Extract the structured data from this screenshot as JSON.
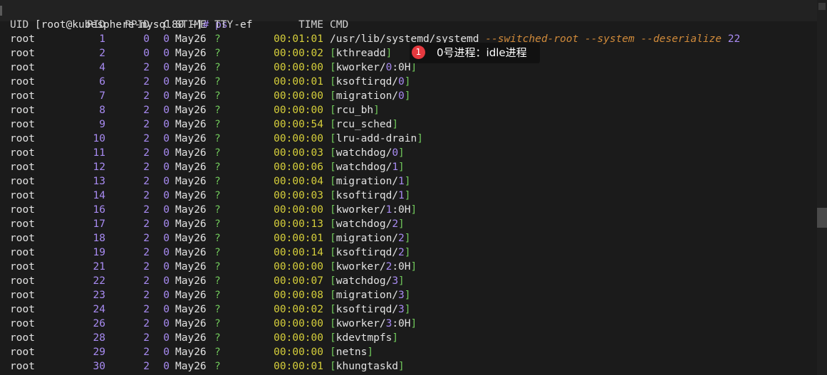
{
  "prompt": {
    "user_host": "[root@kubesphere-mysql80 ~]",
    "symbol": "#",
    "command": "ps",
    "args": "-ef"
  },
  "header": {
    "uid": "UID",
    "pid": "PID",
    "ppid": "PPID",
    "c": "C",
    "stime": "STIME",
    "tty": "TTY",
    "time": "TIME",
    "cmd": "CMD"
  },
  "rows": [
    {
      "uid": "root",
      "pid": "1",
      "ppid": "0",
      "c": "0",
      "stime": "May26",
      "tty": "?",
      "time": "00:01:01",
      "cmd_main": "/usr/lib/systemd/systemd",
      "cmd_opts": "--switched-root --system --deserialize",
      "cmd_num": "22"
    },
    {
      "uid": "root",
      "pid": "2",
      "ppid": "0",
      "c": "0",
      "stime": "May26",
      "tty": "?",
      "time": "00:00:02",
      "cmd_pre": "[",
      "cmd_name": "kthreadd",
      "cmd_suf": "]"
    },
    {
      "uid": "root",
      "pid": "4",
      "ppid": "2",
      "c": "0",
      "stime": "May26",
      "tty": "?",
      "time": "00:00:00",
      "cmd_pre": "[",
      "cmd_name": "kworker/",
      "cmd_n": "0",
      "cmd_tail": ":0H",
      "cmd_suf": "]"
    },
    {
      "uid": "root",
      "pid": "6",
      "ppid": "2",
      "c": "0",
      "stime": "May26",
      "tty": "?",
      "time": "00:00:01",
      "cmd_pre": "[",
      "cmd_name": "ksoftirqd/",
      "cmd_n": "0",
      "cmd_suf": "]"
    },
    {
      "uid": "root",
      "pid": "7",
      "ppid": "2",
      "c": "0",
      "stime": "May26",
      "tty": "?",
      "time": "00:00:00",
      "cmd_pre": "[",
      "cmd_name": "migration/",
      "cmd_n": "0",
      "cmd_suf": "]"
    },
    {
      "uid": "root",
      "pid": "8",
      "ppid": "2",
      "c": "0",
      "stime": "May26",
      "tty": "?",
      "time": "00:00:00",
      "cmd_pre": "[",
      "cmd_name": "rcu_bh",
      "cmd_suf": "]"
    },
    {
      "uid": "root",
      "pid": "9",
      "ppid": "2",
      "c": "0",
      "stime": "May26",
      "tty": "?",
      "time": "00:00:54",
      "cmd_pre": "[",
      "cmd_name": "rcu_sched",
      "cmd_suf": "]"
    },
    {
      "uid": "root",
      "pid": "10",
      "ppid": "2",
      "c": "0",
      "stime": "May26",
      "tty": "?",
      "time": "00:00:00",
      "cmd_pre": "[",
      "cmd_name": "lru-add-drain",
      "cmd_suf": "]"
    },
    {
      "uid": "root",
      "pid": "11",
      "ppid": "2",
      "c": "0",
      "stime": "May26",
      "tty": "?",
      "time": "00:00:03",
      "cmd_pre": "[",
      "cmd_name": "watchdog/",
      "cmd_n": "0",
      "cmd_suf": "]"
    },
    {
      "uid": "root",
      "pid": "12",
      "ppid": "2",
      "c": "0",
      "stime": "May26",
      "tty": "?",
      "time": "00:00:06",
      "cmd_pre": "[",
      "cmd_name": "watchdog/",
      "cmd_n": "1",
      "cmd_suf": "]"
    },
    {
      "uid": "root",
      "pid": "13",
      "ppid": "2",
      "c": "0",
      "stime": "May26",
      "tty": "?",
      "time": "00:00:04",
      "cmd_pre": "[",
      "cmd_name": "migration/",
      "cmd_n": "1",
      "cmd_suf": "]"
    },
    {
      "uid": "root",
      "pid": "14",
      "ppid": "2",
      "c": "0",
      "stime": "May26",
      "tty": "?",
      "time": "00:00:03",
      "cmd_pre": "[",
      "cmd_name": "ksoftirqd/",
      "cmd_n": "1",
      "cmd_suf": "]"
    },
    {
      "uid": "root",
      "pid": "16",
      "ppid": "2",
      "c": "0",
      "stime": "May26",
      "tty": "?",
      "time": "00:00:00",
      "cmd_pre": "[",
      "cmd_name": "kworker/",
      "cmd_n": "1",
      "cmd_tail": ":0H",
      "cmd_suf": "]"
    },
    {
      "uid": "root",
      "pid": "17",
      "ppid": "2",
      "c": "0",
      "stime": "May26",
      "tty": "?",
      "time": "00:00:13",
      "cmd_pre": "[",
      "cmd_name": "watchdog/",
      "cmd_n": "2",
      "cmd_suf": "]"
    },
    {
      "uid": "root",
      "pid": "18",
      "ppid": "2",
      "c": "0",
      "stime": "May26",
      "tty": "?",
      "time": "00:00:01",
      "cmd_pre": "[",
      "cmd_name": "migration/",
      "cmd_n": "2",
      "cmd_suf": "]"
    },
    {
      "uid": "root",
      "pid": "19",
      "ppid": "2",
      "c": "0",
      "stime": "May26",
      "tty": "?",
      "time": "00:00:14",
      "cmd_pre": "[",
      "cmd_name": "ksoftirqd/",
      "cmd_n": "2",
      "cmd_suf": "]"
    },
    {
      "uid": "root",
      "pid": "21",
      "ppid": "2",
      "c": "0",
      "stime": "May26",
      "tty": "?",
      "time": "00:00:00",
      "cmd_pre": "[",
      "cmd_name": "kworker/",
      "cmd_n": "2",
      "cmd_tail": ":0H",
      "cmd_suf": "]"
    },
    {
      "uid": "root",
      "pid": "22",
      "ppid": "2",
      "c": "0",
      "stime": "May26",
      "tty": "?",
      "time": "00:00:07",
      "cmd_pre": "[",
      "cmd_name": "watchdog/",
      "cmd_n": "3",
      "cmd_suf": "]"
    },
    {
      "uid": "root",
      "pid": "23",
      "ppid": "2",
      "c": "0",
      "stime": "May26",
      "tty": "?",
      "time": "00:00:08",
      "cmd_pre": "[",
      "cmd_name": "migration/",
      "cmd_n": "3",
      "cmd_suf": "]"
    },
    {
      "uid": "root",
      "pid": "24",
      "ppid": "2",
      "c": "0",
      "stime": "May26",
      "tty": "?",
      "time": "00:00:02",
      "cmd_pre": "[",
      "cmd_name": "ksoftirqd/",
      "cmd_n": "3",
      "cmd_suf": "]"
    },
    {
      "uid": "root",
      "pid": "26",
      "ppid": "2",
      "c": "0",
      "stime": "May26",
      "tty": "?",
      "time": "00:00:00",
      "cmd_pre": "[",
      "cmd_name": "kworker/",
      "cmd_n": "3",
      "cmd_tail": ":0H",
      "cmd_suf": "]"
    },
    {
      "uid": "root",
      "pid": "28",
      "ppid": "2",
      "c": "0",
      "stime": "May26",
      "tty": "?",
      "time": "00:00:00",
      "cmd_pre": "[",
      "cmd_name": "kdevtmpfs",
      "cmd_suf": "]"
    },
    {
      "uid": "root",
      "pid": "29",
      "ppid": "2",
      "c": "0",
      "stime": "May26",
      "tty": "?",
      "time": "00:00:00",
      "cmd_pre": "[",
      "cmd_name": "netns",
      "cmd_suf": "]"
    },
    {
      "uid": "root",
      "pid": "30",
      "ppid": "2",
      "c": "0",
      "stime": "May26",
      "tty": "?",
      "time": "00:00:01",
      "cmd_pre": "[",
      "cmd_name": "khungtaskd",
      "cmd_suf": "]"
    }
  ],
  "annotation": {
    "badge": "1",
    "text": "0号进程：idle进程"
  },
  "colors": {
    "background": "#1b1b1b",
    "number": "#a88bf2",
    "time": "#d6cf3b",
    "bracket": "#71c95b",
    "option": "#d08a3a"
  }
}
